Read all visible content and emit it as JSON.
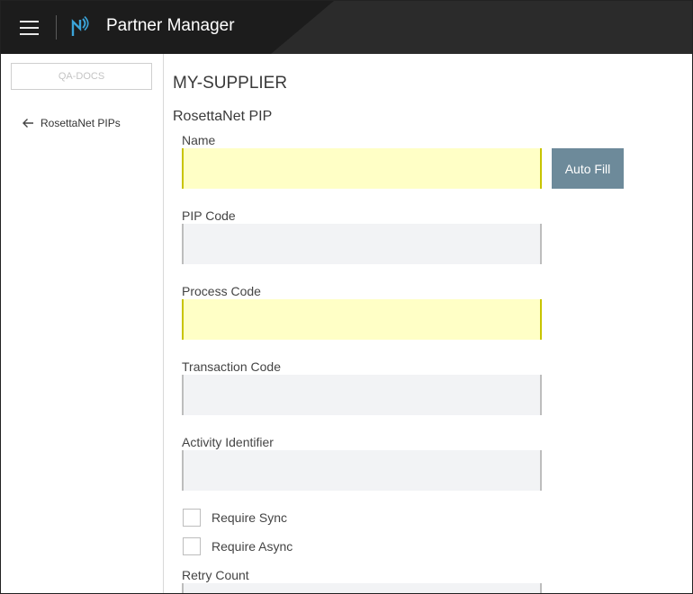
{
  "header": {
    "app_title": "Partner Manager",
    "menu_icon": "hamburger-menu-icon",
    "logo_icon": "partner-manager-logo-icon",
    "background_color": "#2b2b2b"
  },
  "sidebar": {
    "tenant": "QA-DOCS",
    "back_link": {
      "label": "RosettaNet PIPs",
      "icon": "arrow-left-icon"
    }
  },
  "main": {
    "partner_name": "MY-SUPPLIER",
    "section_title": "RosettaNet PIP",
    "autofill_label": "Auto Fill",
    "fields": {
      "name": {
        "label": "Name",
        "value": "",
        "required": true
      },
      "pip_code": {
        "label": "PIP Code",
        "value": "",
        "required": false
      },
      "process_code": {
        "label": "Process Code",
        "value": "",
        "required": true
      },
      "transaction_code": {
        "label": "Transaction Code",
        "value": "",
        "required": false
      },
      "activity_identifier": {
        "label": "Activity Identifier",
        "value": "",
        "required": false
      },
      "retry_count": {
        "label": "Retry Count",
        "value": "",
        "required": false
      }
    },
    "checkboxes": {
      "require_sync": {
        "label": "Require Sync",
        "checked": false
      },
      "require_async": {
        "label": "Require Async",
        "checked": false
      }
    }
  },
  "colors": {
    "required_field_bg": "#ffffc6",
    "optional_field_bg": "#f2f3f5",
    "autofill_button_bg": "#6d8a9a"
  }
}
